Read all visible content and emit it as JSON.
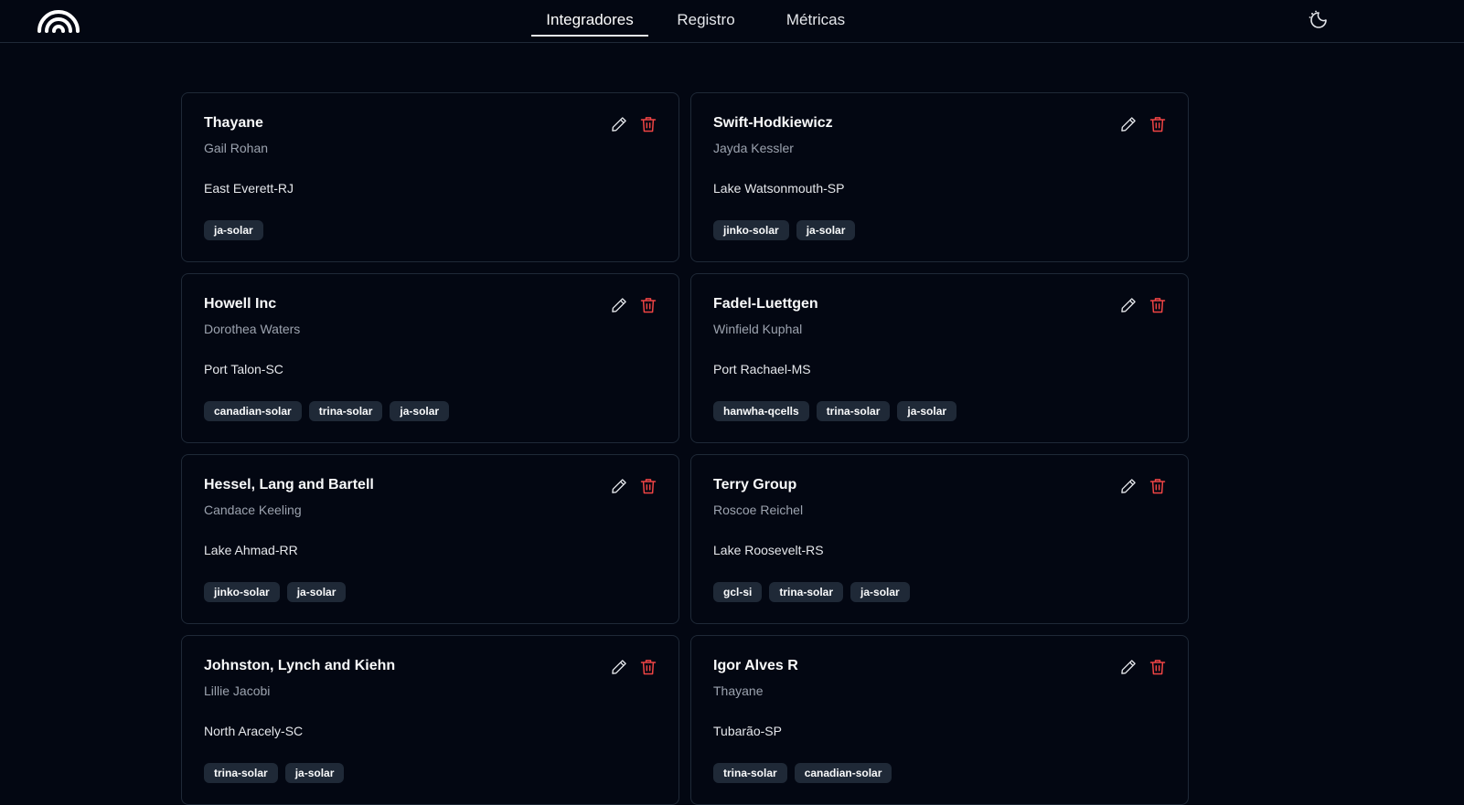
{
  "nav": {
    "items": [
      {
        "label": "Integradores",
        "active": true
      },
      {
        "label": "Registro",
        "active": false
      },
      {
        "label": "Métricas",
        "active": false
      }
    ]
  },
  "icons": {
    "logo": "rainbow-logo-icon",
    "theme_toggle": "moon-sun-toggle-icon",
    "edit": "pencil-icon",
    "delete": "trash-icon"
  },
  "colors": {
    "background": "#030712",
    "border": "#1f2937",
    "tag_bg": "#1f2937",
    "delete_red": "#ef4444",
    "muted_text": "#9ca3af"
  },
  "integrators": [
    {
      "name": "Thayane",
      "contact": "Gail Rohan",
      "location": "East Everett-RJ",
      "tags": [
        "ja-solar"
      ]
    },
    {
      "name": "Swift-Hodkiewicz",
      "contact": "Jayda Kessler",
      "location": "Lake Watsonmouth-SP",
      "tags": [
        "jinko-solar",
        "ja-solar"
      ]
    },
    {
      "name": "Howell Inc",
      "contact": "Dorothea Waters",
      "location": "Port Talon-SC",
      "tags": [
        "canadian-solar",
        "trina-solar",
        "ja-solar"
      ]
    },
    {
      "name": "Fadel-Luettgen",
      "contact": "Winfield Kuphal",
      "location": "Port Rachael-MS",
      "tags": [
        "hanwha-qcells",
        "trina-solar",
        "ja-solar"
      ]
    },
    {
      "name": "Hessel, Lang and Bartell",
      "contact": "Candace Keeling",
      "location": "Lake Ahmad-RR",
      "tags": [
        "jinko-solar",
        "ja-solar"
      ]
    },
    {
      "name": "Terry Group",
      "contact": "Roscoe Reichel",
      "location": "Lake Roosevelt-RS",
      "tags": [
        "gcl-si",
        "trina-solar",
        "ja-solar"
      ]
    },
    {
      "name": "Johnston, Lynch and Kiehn",
      "contact": "Lillie Jacobi",
      "location": "North Aracely-SC",
      "tags": [
        "trina-solar",
        "ja-solar"
      ]
    },
    {
      "name": "Igor Alves R",
      "contact": "Thayane",
      "location": "Tubarão-SP",
      "tags": [
        "trina-solar",
        "canadian-solar"
      ]
    }
  ]
}
